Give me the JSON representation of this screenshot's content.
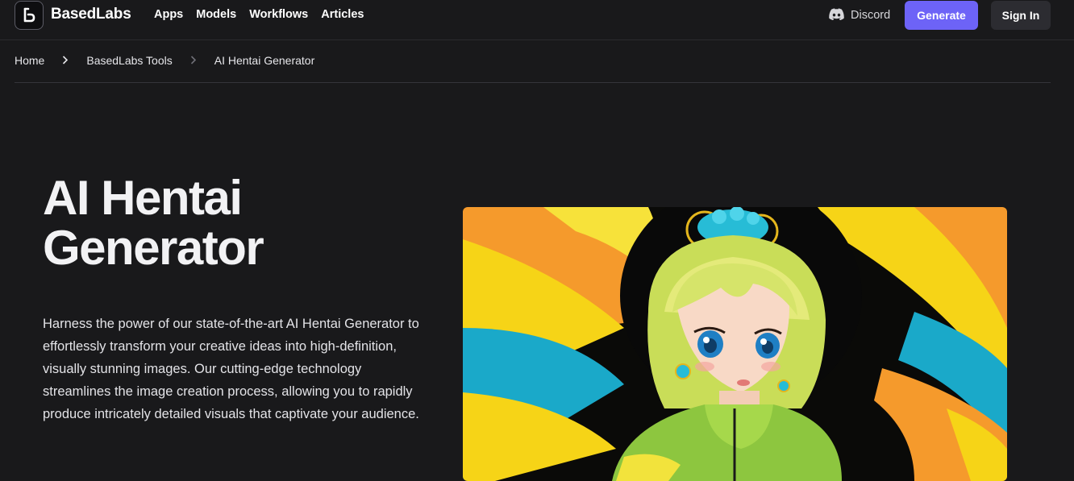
{
  "header": {
    "brand": "BasedLabs",
    "nav": [
      "Apps",
      "Models",
      "Workflows",
      "Articles"
    ],
    "discord_label": "Discord",
    "generate_label": "Generate",
    "signin_label": "Sign In"
  },
  "breadcrumb": {
    "items": [
      "Home",
      "BasedLabs Tools",
      "AI Hentai Generator"
    ]
  },
  "hero": {
    "title_line1": "AI Hentai",
    "title_line2": "Generator",
    "description": "Harness the power of our state-of-the-art AI Hentai Generator to effortlessly transform your creative ideas into high-definition, visually stunning images. Our cutting-edge technology streamlines the image creation process, allowing you to rapidly produce intricately detailed visuals that captivate your audience."
  },
  "colors": {
    "background": "#19191b",
    "accent": "#6d63f7"
  },
  "icons": [
    "basedlabs-logo-icon",
    "discord-icon",
    "chevron-right-icon"
  ]
}
